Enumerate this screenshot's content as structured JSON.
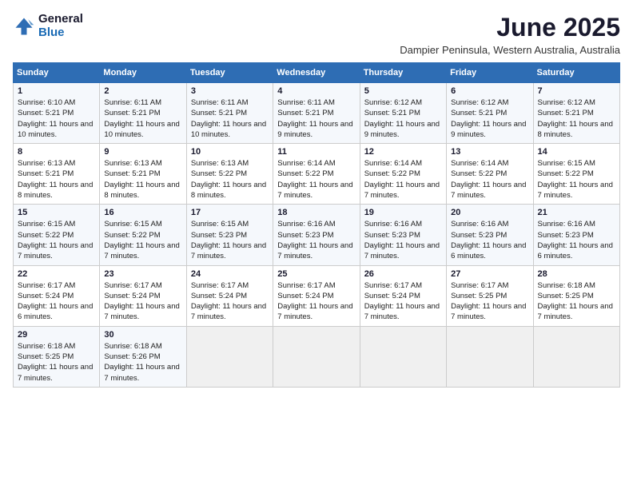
{
  "header": {
    "logo_general": "General",
    "logo_blue": "Blue",
    "month_title": "June 2025",
    "subtitle": "Dampier Peninsula, Western Australia, Australia"
  },
  "weekdays": [
    "Sunday",
    "Monday",
    "Tuesday",
    "Wednesday",
    "Thursday",
    "Friday",
    "Saturday"
  ],
  "weeks": [
    [
      {
        "day": "1",
        "sunrise": "6:10 AM",
        "sunset": "5:21 PM",
        "daylight": "11 hours and 10 minutes."
      },
      {
        "day": "2",
        "sunrise": "6:11 AM",
        "sunset": "5:21 PM",
        "daylight": "11 hours and 10 minutes."
      },
      {
        "day": "3",
        "sunrise": "6:11 AM",
        "sunset": "5:21 PM",
        "daylight": "11 hours and 10 minutes."
      },
      {
        "day": "4",
        "sunrise": "6:11 AM",
        "sunset": "5:21 PM",
        "daylight": "11 hours and 9 minutes."
      },
      {
        "day": "5",
        "sunrise": "6:12 AM",
        "sunset": "5:21 PM",
        "daylight": "11 hours and 9 minutes."
      },
      {
        "day": "6",
        "sunrise": "6:12 AM",
        "sunset": "5:21 PM",
        "daylight": "11 hours and 9 minutes."
      },
      {
        "day": "7",
        "sunrise": "6:12 AM",
        "sunset": "5:21 PM",
        "daylight": "11 hours and 8 minutes."
      }
    ],
    [
      {
        "day": "8",
        "sunrise": "6:13 AM",
        "sunset": "5:21 PM",
        "daylight": "11 hours and 8 minutes."
      },
      {
        "day": "9",
        "sunrise": "6:13 AM",
        "sunset": "5:21 PM",
        "daylight": "11 hours and 8 minutes."
      },
      {
        "day": "10",
        "sunrise": "6:13 AM",
        "sunset": "5:22 PM",
        "daylight": "11 hours and 8 minutes."
      },
      {
        "day": "11",
        "sunrise": "6:14 AM",
        "sunset": "5:22 PM",
        "daylight": "11 hours and 7 minutes."
      },
      {
        "day": "12",
        "sunrise": "6:14 AM",
        "sunset": "5:22 PM",
        "daylight": "11 hours and 7 minutes."
      },
      {
        "day": "13",
        "sunrise": "6:14 AM",
        "sunset": "5:22 PM",
        "daylight": "11 hours and 7 minutes."
      },
      {
        "day": "14",
        "sunrise": "6:15 AM",
        "sunset": "5:22 PM",
        "daylight": "11 hours and 7 minutes."
      }
    ],
    [
      {
        "day": "15",
        "sunrise": "6:15 AM",
        "sunset": "5:22 PM",
        "daylight": "11 hours and 7 minutes."
      },
      {
        "day": "16",
        "sunrise": "6:15 AM",
        "sunset": "5:22 PM",
        "daylight": "11 hours and 7 minutes."
      },
      {
        "day": "17",
        "sunrise": "6:15 AM",
        "sunset": "5:23 PM",
        "daylight": "11 hours and 7 minutes."
      },
      {
        "day": "18",
        "sunrise": "6:16 AM",
        "sunset": "5:23 PM",
        "daylight": "11 hours and 7 minutes."
      },
      {
        "day": "19",
        "sunrise": "6:16 AM",
        "sunset": "5:23 PM",
        "daylight": "11 hours and 7 minutes."
      },
      {
        "day": "20",
        "sunrise": "6:16 AM",
        "sunset": "5:23 PM",
        "daylight": "11 hours and 6 minutes."
      },
      {
        "day": "21",
        "sunrise": "6:16 AM",
        "sunset": "5:23 PM",
        "daylight": "11 hours and 6 minutes."
      }
    ],
    [
      {
        "day": "22",
        "sunrise": "6:17 AM",
        "sunset": "5:24 PM",
        "daylight": "11 hours and 6 minutes."
      },
      {
        "day": "23",
        "sunrise": "6:17 AM",
        "sunset": "5:24 PM",
        "daylight": "11 hours and 7 minutes."
      },
      {
        "day": "24",
        "sunrise": "6:17 AM",
        "sunset": "5:24 PM",
        "daylight": "11 hours and 7 minutes."
      },
      {
        "day": "25",
        "sunrise": "6:17 AM",
        "sunset": "5:24 PM",
        "daylight": "11 hours and 7 minutes."
      },
      {
        "day": "26",
        "sunrise": "6:17 AM",
        "sunset": "5:24 PM",
        "daylight": "11 hours and 7 minutes."
      },
      {
        "day": "27",
        "sunrise": "6:17 AM",
        "sunset": "5:25 PM",
        "daylight": "11 hours and 7 minutes."
      },
      {
        "day": "28",
        "sunrise": "6:18 AM",
        "sunset": "5:25 PM",
        "daylight": "11 hours and 7 minutes."
      }
    ],
    [
      {
        "day": "29",
        "sunrise": "6:18 AM",
        "sunset": "5:25 PM",
        "daylight": "11 hours and 7 minutes."
      },
      {
        "day": "30",
        "sunrise": "6:18 AM",
        "sunset": "5:26 PM",
        "daylight": "11 hours and 7 minutes."
      },
      null,
      null,
      null,
      null,
      null
    ]
  ]
}
